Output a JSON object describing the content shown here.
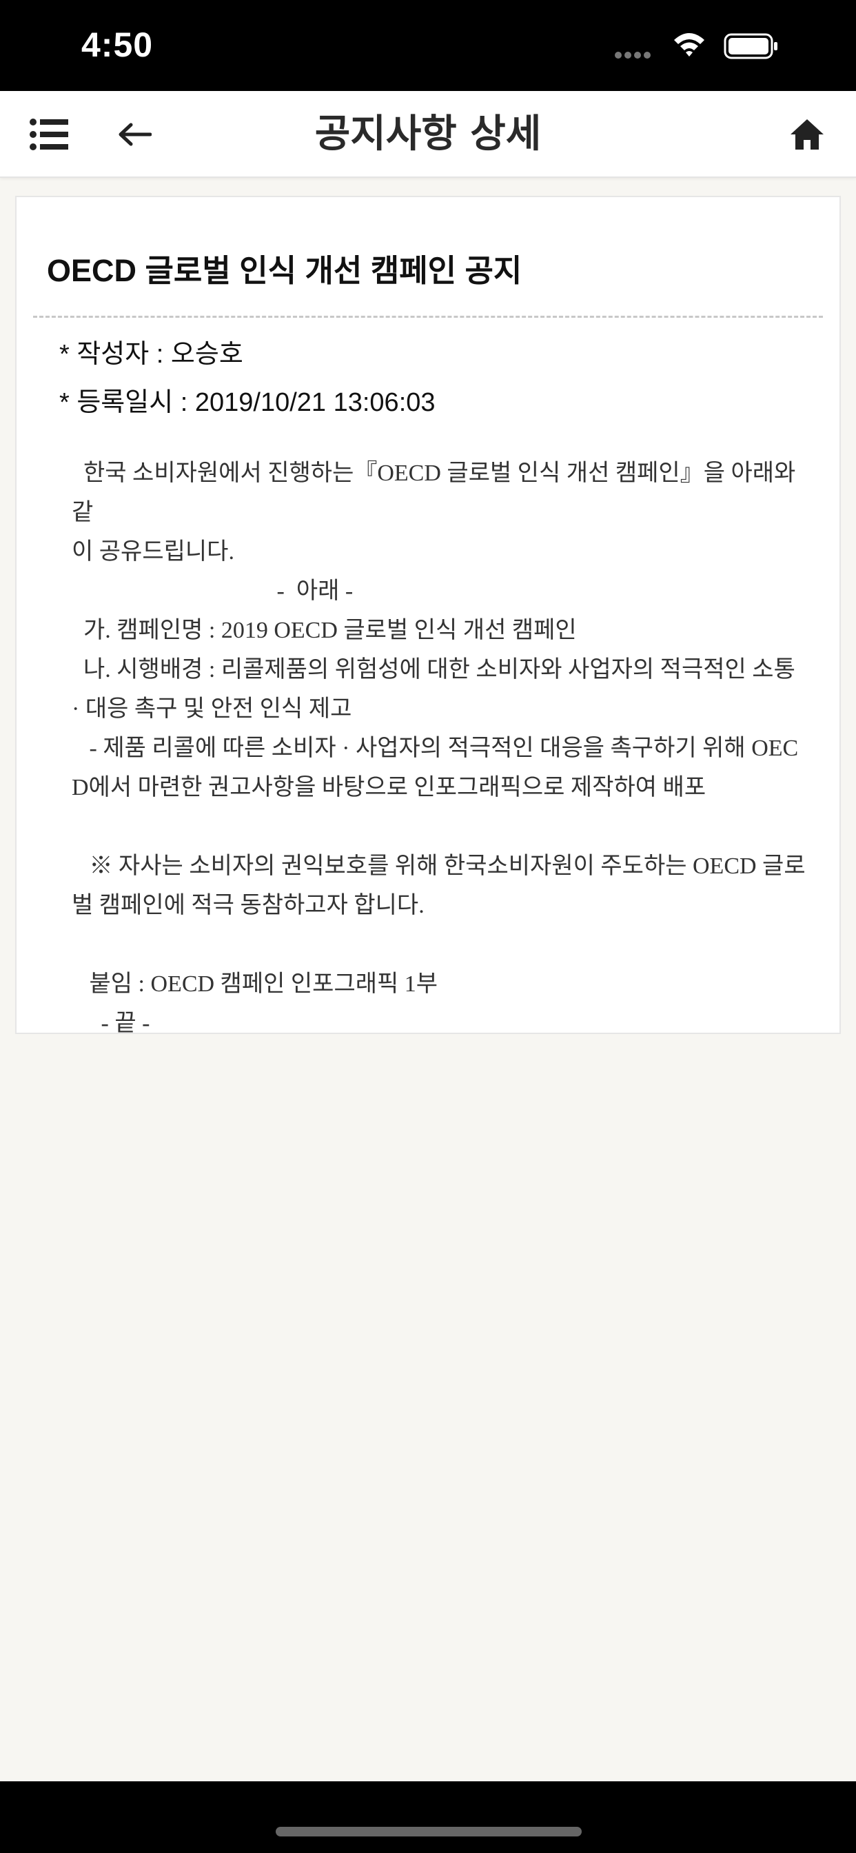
{
  "status_bar": {
    "time": "4:50"
  },
  "header": {
    "title": "공지사항 상세",
    "icons": {
      "menu": "list-menu-icon",
      "back": "arrow-left-icon",
      "home": "home-icon"
    }
  },
  "notice": {
    "title": "OECD 글로벌 인식 개선 캠페인 공지",
    "author_line": "* 작성자 : 오승호",
    "date_line": "* 등록일시 : 2019/10/21 13:06:03",
    "body": [
      "  한국 소비자원에서 진행하는『OECD 글로벌 인식 개선 캠페인』을 아래와 같",
      "이 공유드립니다.",
      "                                   -  아래 -",
      "  가. 캠페인명 : 2019 OECD 글로벌 인식 개선 캠페인",
      "  나. 시행배경 : 리콜제품의 위험성에 대한 소비자와 사업자의 적극적인 소통",
      "· 대응 촉구 및 안전 인식 제고",
      "   - 제품 리콜에 따른 소비자 · 사업자의 적극적인 대응을 촉구하기 위해 OEC",
      "D에서 마련한 권고사항을 바탕으로 인포그래픽으로 제작하여 배포",
      "",
      "   ※ 자사는 소비자의 권익보호를 위해 한국소비자원이 주도하는 OECD 글로",
      "벌 캠페인에 적극 동참하고자 합니다.",
      "",
      "   붙임 : OECD 캠페인 인포그래픽 1부",
      "     - 끝 -"
    ]
  },
  "colors": {
    "status_bar_bg": "#000000",
    "page_bg": "#f7f6f2",
    "card_bg": "#ffffff"
  }
}
